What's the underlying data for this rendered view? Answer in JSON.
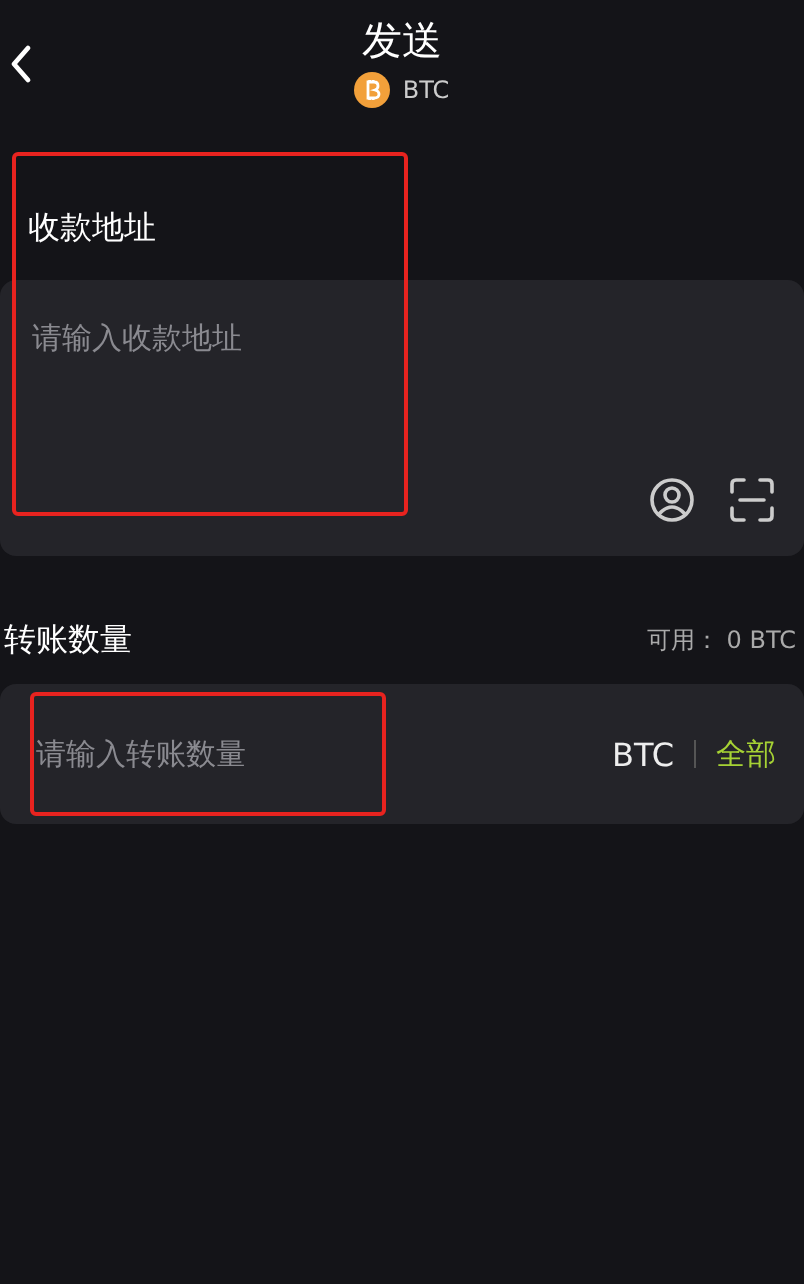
{
  "header": {
    "title": "发送",
    "coin": "BTC"
  },
  "address": {
    "label": "收款地址",
    "placeholder": "请输入收款地址",
    "highlighted": true
  },
  "amount": {
    "label": "转账数量",
    "available": "可用： 0 BTC",
    "placeholder": "请输入转账数量",
    "unit": "BTC",
    "all_button": "全部",
    "highlighted": true
  }
}
